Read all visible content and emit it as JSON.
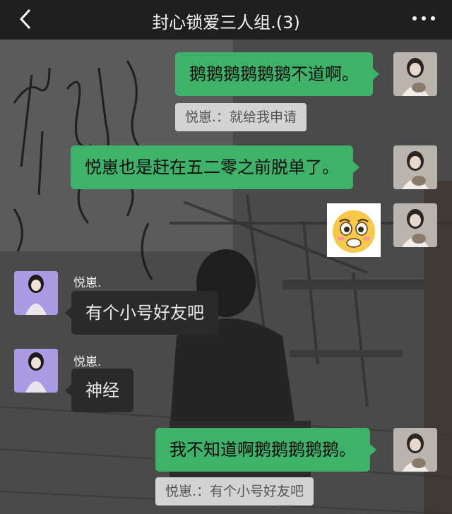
{
  "header": {
    "back_icon": "chevron-left-icon",
    "title": "封心锁爱三人组.(3)",
    "more_icon": "more-dots-icon"
  },
  "messages": [
    {
      "side": "me",
      "text": "鹅鹅鹅鹅鹅鹅不道啊。",
      "quote": "悦崽.：就给我申请"
    },
    {
      "side": "me",
      "text": "悦崽也是赶在五二零之前脱单了。"
    },
    {
      "side": "me",
      "sticker": "worried-face-sticker"
    },
    {
      "side": "them",
      "sender": "悦崽.",
      "text": "有个小号好友吧"
    },
    {
      "side": "them",
      "sender": "悦崽.",
      "text": "神经"
    },
    {
      "side": "me",
      "text": "我不知道啊鹅鹅鹅鹅鹅。",
      "quote": "悦崽.：有个小号好友吧"
    }
  ],
  "colors": {
    "my_bubble": "#3fb26a",
    "their_bubble": "#2a2a2a",
    "header": "#1f1f1f"
  }
}
